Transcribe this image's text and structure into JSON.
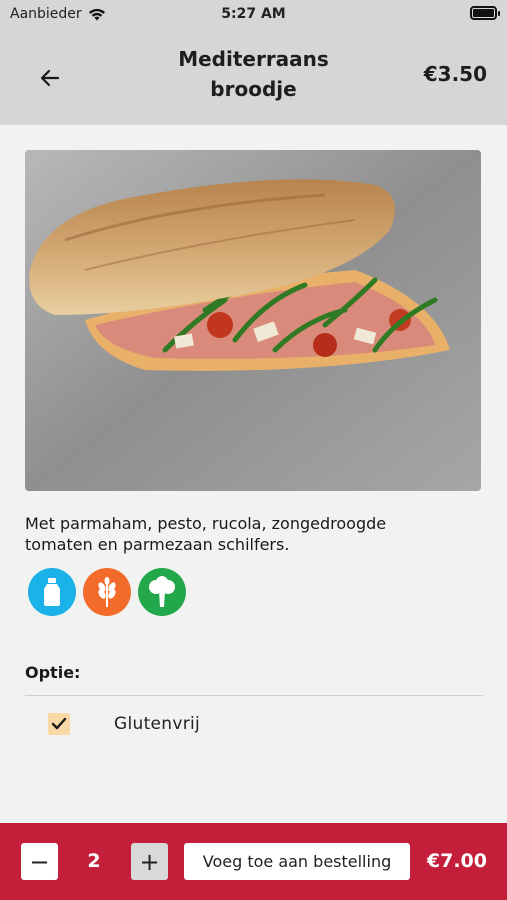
{
  "status_bar": {
    "carrier": "Aanbieder",
    "time": "5:27 AM",
    "icons": [
      "wifi-icon",
      "battery-icon"
    ]
  },
  "header": {
    "back_icon": "arrow-left-icon",
    "title_line1": "Mediterraans",
    "title_line2": "broodje",
    "price": "€3.50"
  },
  "product": {
    "image": "sandwich-photo",
    "description_line1": "Met parmaham, pesto, rucola, zongedroogde",
    "description_line2": "tomaten en parmezaan schilfers.",
    "allergens": [
      {
        "icon": "milk-bottle-icon",
        "color": "#1ab2e8"
      },
      {
        "icon": "wheat-icon",
        "color": "#f26b2b"
      },
      {
        "icon": "broccoli-icon",
        "color": "#22a84a"
      }
    ]
  },
  "options": {
    "label": "Optie:",
    "items": [
      {
        "label": "Glutenvrij",
        "checked": true
      }
    ]
  },
  "footer": {
    "minus_label": "−",
    "quantity": "2",
    "plus_label": "+",
    "add_label": "Voeg toe aan bestelling",
    "total": "€7.00",
    "background_color": "#c41e3a"
  }
}
